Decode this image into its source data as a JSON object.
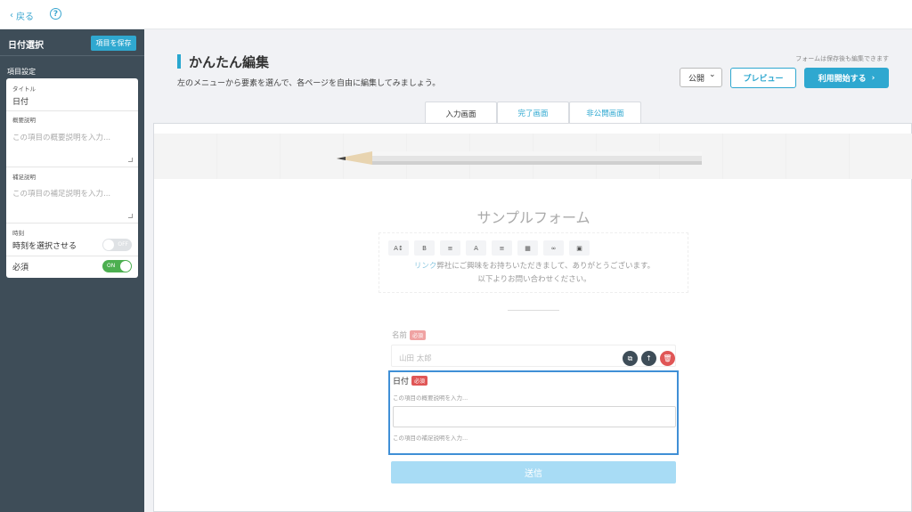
{
  "topbar": {
    "back_label": "戻る",
    "back_chevron": "‹",
    "help_glyph": "?"
  },
  "sidebar": {
    "title": "日付選択",
    "save_label": "項目を保存",
    "section_label": "項目設定",
    "fields": {
      "title_label": "タイトル",
      "title_value": "日付",
      "summary_label": "概要説明",
      "summary_placeholder": "この項目の概要説明を入力...",
      "supplement_label": "補足説明",
      "supplement_placeholder": "この項目の補足説明を入力...",
      "time_label": "時刻",
      "time_toggle_label": "時刻を選択させる",
      "time_toggle_state": "OFF",
      "required_label": "必須",
      "required_toggle_state": "ON"
    }
  },
  "header": {
    "title": "かんたん編集",
    "subtitle": "左のメニューから要素を選んで、各ページを自由に編集してみましょう。",
    "note": "フォームは保存後も編集できます",
    "publish_value": "公開",
    "publish_chevron": "⌄",
    "preview_label": "プレビュー",
    "start_label": "利用開始する",
    "start_chevron": "›"
  },
  "tabs": [
    {
      "label": "入力画面",
      "active": true
    },
    {
      "label": "完了画面",
      "active": false
    },
    {
      "label": "非公開画面",
      "active": false
    }
  ],
  "form": {
    "title": "サンプルフォーム",
    "toolbar": [
      "A↕",
      "B",
      "≡",
      "A",
      "≡",
      "▦",
      "∞",
      "▣"
    ],
    "intro_link": "リンク",
    "intro_line1_rest": "弊社にご興味をお持ちいただきまして、ありがとうございます。",
    "intro_line2": "以下よりお問い合わせください。",
    "name_label": "名前",
    "required_badge": "必須",
    "name_placeholder": "山田 太郎",
    "actions": {
      "copy": "⧉",
      "up": "↑",
      "delete": "🗑"
    },
    "date_label": "日付",
    "date_summary_placeholder": "この項目の概要説明を入力...",
    "date_supplement_placeholder": "この項目の補足説明を入力...",
    "submit_label": "送信"
  },
  "colors": {
    "accent": "#2fa8d0",
    "sidebar": "#3e4d58",
    "selection": "#3f8fd6",
    "required": "#e05656",
    "toggle_on": "#4caf50"
  }
}
